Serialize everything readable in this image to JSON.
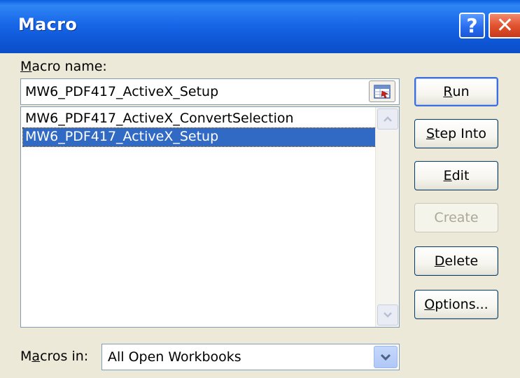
{
  "window": {
    "title": "Macro",
    "help_glyph": "?",
    "close_glyph": "✕"
  },
  "macro_name": {
    "label_access": "M",
    "label_rest": "acro name:",
    "value": "MW6_PDF417_ActiveX_Setup"
  },
  "macro_list": {
    "items": [
      "MW6_PDF417_ActiveX_ConvertSelection",
      "MW6_PDF417_ActiveX_Setup"
    ],
    "selected_index": 1
  },
  "buttons": {
    "run": {
      "access": "R",
      "rest": "un"
    },
    "step_into": {
      "access": "S",
      "rest": "tep Into"
    },
    "edit": {
      "access": "E",
      "rest": "dit"
    },
    "create": {
      "label": "Create",
      "disabled": true
    },
    "delete": {
      "access": "D",
      "rest": "elete"
    },
    "options": {
      "access": "O",
      "rest": "ptions..."
    }
  },
  "macros_in": {
    "label_pre": "M",
    "label_access": "a",
    "label_post": "cros in:",
    "value": "All Open Workbooks"
  },
  "colors": {
    "titlebar": "#0a5ee0",
    "selection": "#316ac5",
    "dialog_bg": "#ece9d8"
  }
}
